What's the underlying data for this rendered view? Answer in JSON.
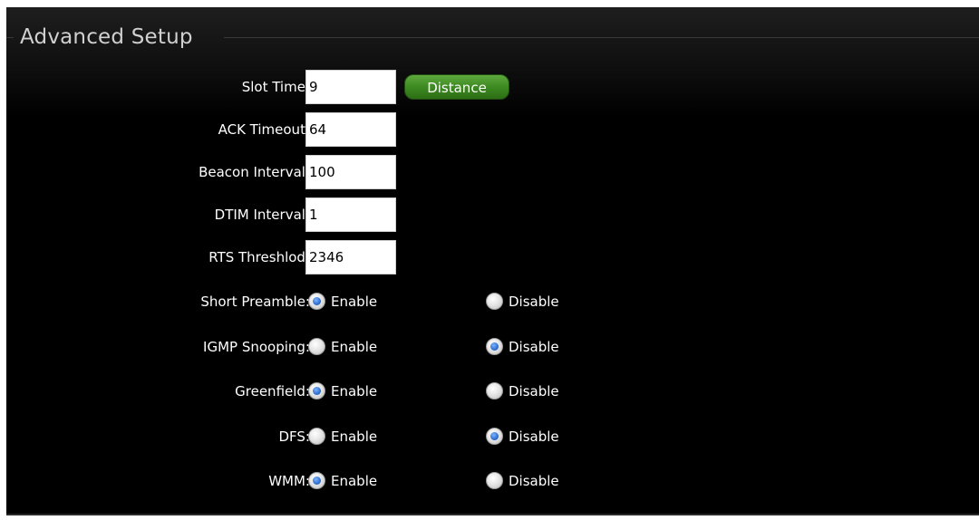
{
  "title": "Advanced Setup",
  "fields": {
    "slot_time": {
      "label": "Slot Time:",
      "value": "9"
    },
    "ack_timeout": {
      "label": "ACK Timeout:",
      "value": "64"
    },
    "beacon_interval": {
      "label": "Beacon Interval:",
      "value": "100"
    },
    "dtim_interval": {
      "label": "DTIM Interval:",
      "value": "1"
    },
    "rts_threshold": {
      "label": "RTS Threshlod:",
      "value": "2346"
    }
  },
  "distance_button": "Distance",
  "options": {
    "enable_label": "Enable",
    "disable_label": "Disable",
    "short_preamble": {
      "label": "Short Preamble:",
      "selected": "enable"
    },
    "igmp_snooping": {
      "label": "IGMP Snooping:",
      "selected": "disable"
    },
    "greenfield": {
      "label": "Greenfield:",
      "selected": "enable"
    },
    "dfs": {
      "label": "DFS:",
      "selected": "disable"
    },
    "wmm": {
      "label": "WMM:",
      "selected": "enable"
    }
  },
  "colors": {
    "panel_bg": "#000000",
    "button_green": "#3d8a22",
    "radio_selected": "#2f6fd0"
  }
}
